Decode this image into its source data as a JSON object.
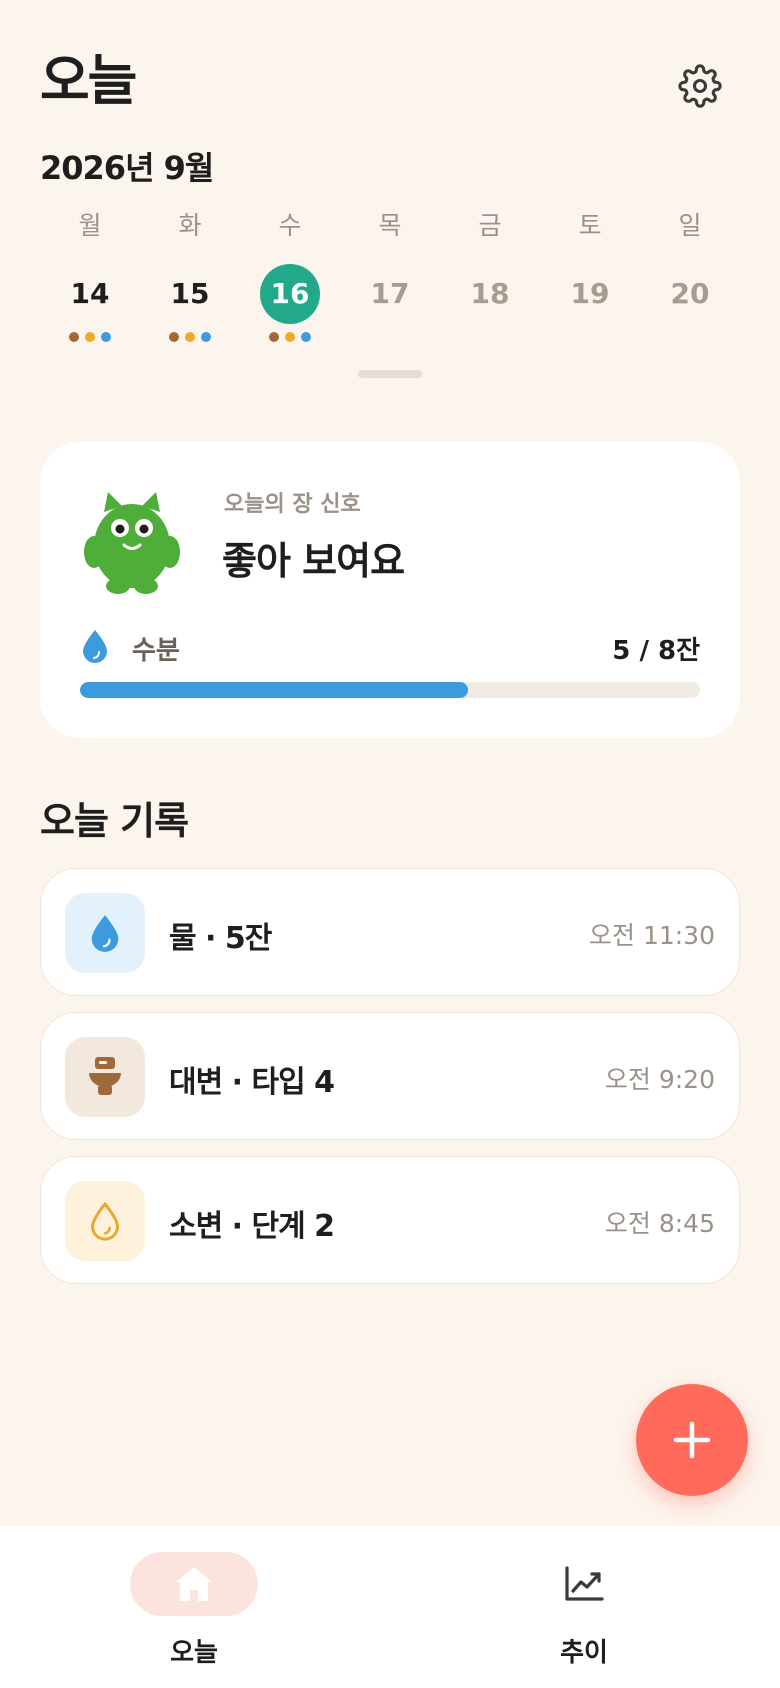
{
  "header": {
    "title": "오늘",
    "month": "2026년 9월"
  },
  "week": {
    "days": [
      {
        "weekday": "월",
        "date": "14",
        "state": "past",
        "dots": [
          "#A0693A",
          "#F0A92C",
          "#3C9BDC"
        ]
      },
      {
        "weekday": "화",
        "date": "15",
        "state": "past",
        "dots": [
          "#A0693A",
          "#F0A92C",
          "#3C9BDC"
        ]
      },
      {
        "weekday": "수",
        "date": "16",
        "state": "selected",
        "dots": [
          "#A0693A",
          "#F0A92C",
          "#3C9BDC"
        ]
      },
      {
        "weekday": "목",
        "date": "17",
        "state": "future",
        "dots": []
      },
      {
        "weekday": "금",
        "date": "18",
        "state": "future",
        "dots": []
      },
      {
        "weekday": "토",
        "date": "19",
        "state": "future",
        "dots": []
      },
      {
        "weekday": "일",
        "date": "20",
        "state": "future",
        "dots": []
      }
    ]
  },
  "status": {
    "label": "오늘의 장 신호",
    "value": "좋아 보여요",
    "mascot_color": "#4FAE3A",
    "water_label": "수분",
    "water_count": "5 / 8잔",
    "water_fraction": 0.625
  },
  "records": {
    "title": "오늘 기록",
    "items": [
      {
        "icon": "water-drop-icon",
        "icon_bg": "#E3F1FC",
        "title": "물 · 5잔",
        "time": "오전 11:30"
      },
      {
        "icon": "toilet-icon",
        "icon_bg": "#F2E8DE",
        "title": "대변 · 타입 4",
        "time": "오전 9:20"
      },
      {
        "icon": "urine-drop-icon",
        "icon_bg": "#FEF2DC",
        "title": "소변 · 단계 2",
        "time": "오전 8:45"
      }
    ]
  },
  "nav": {
    "today_label": "오늘",
    "trend_label": "추이"
  },
  "colors": {
    "accent": "#22A98A",
    "fab": "#FF6A5A",
    "water": "#3C9BDC"
  }
}
